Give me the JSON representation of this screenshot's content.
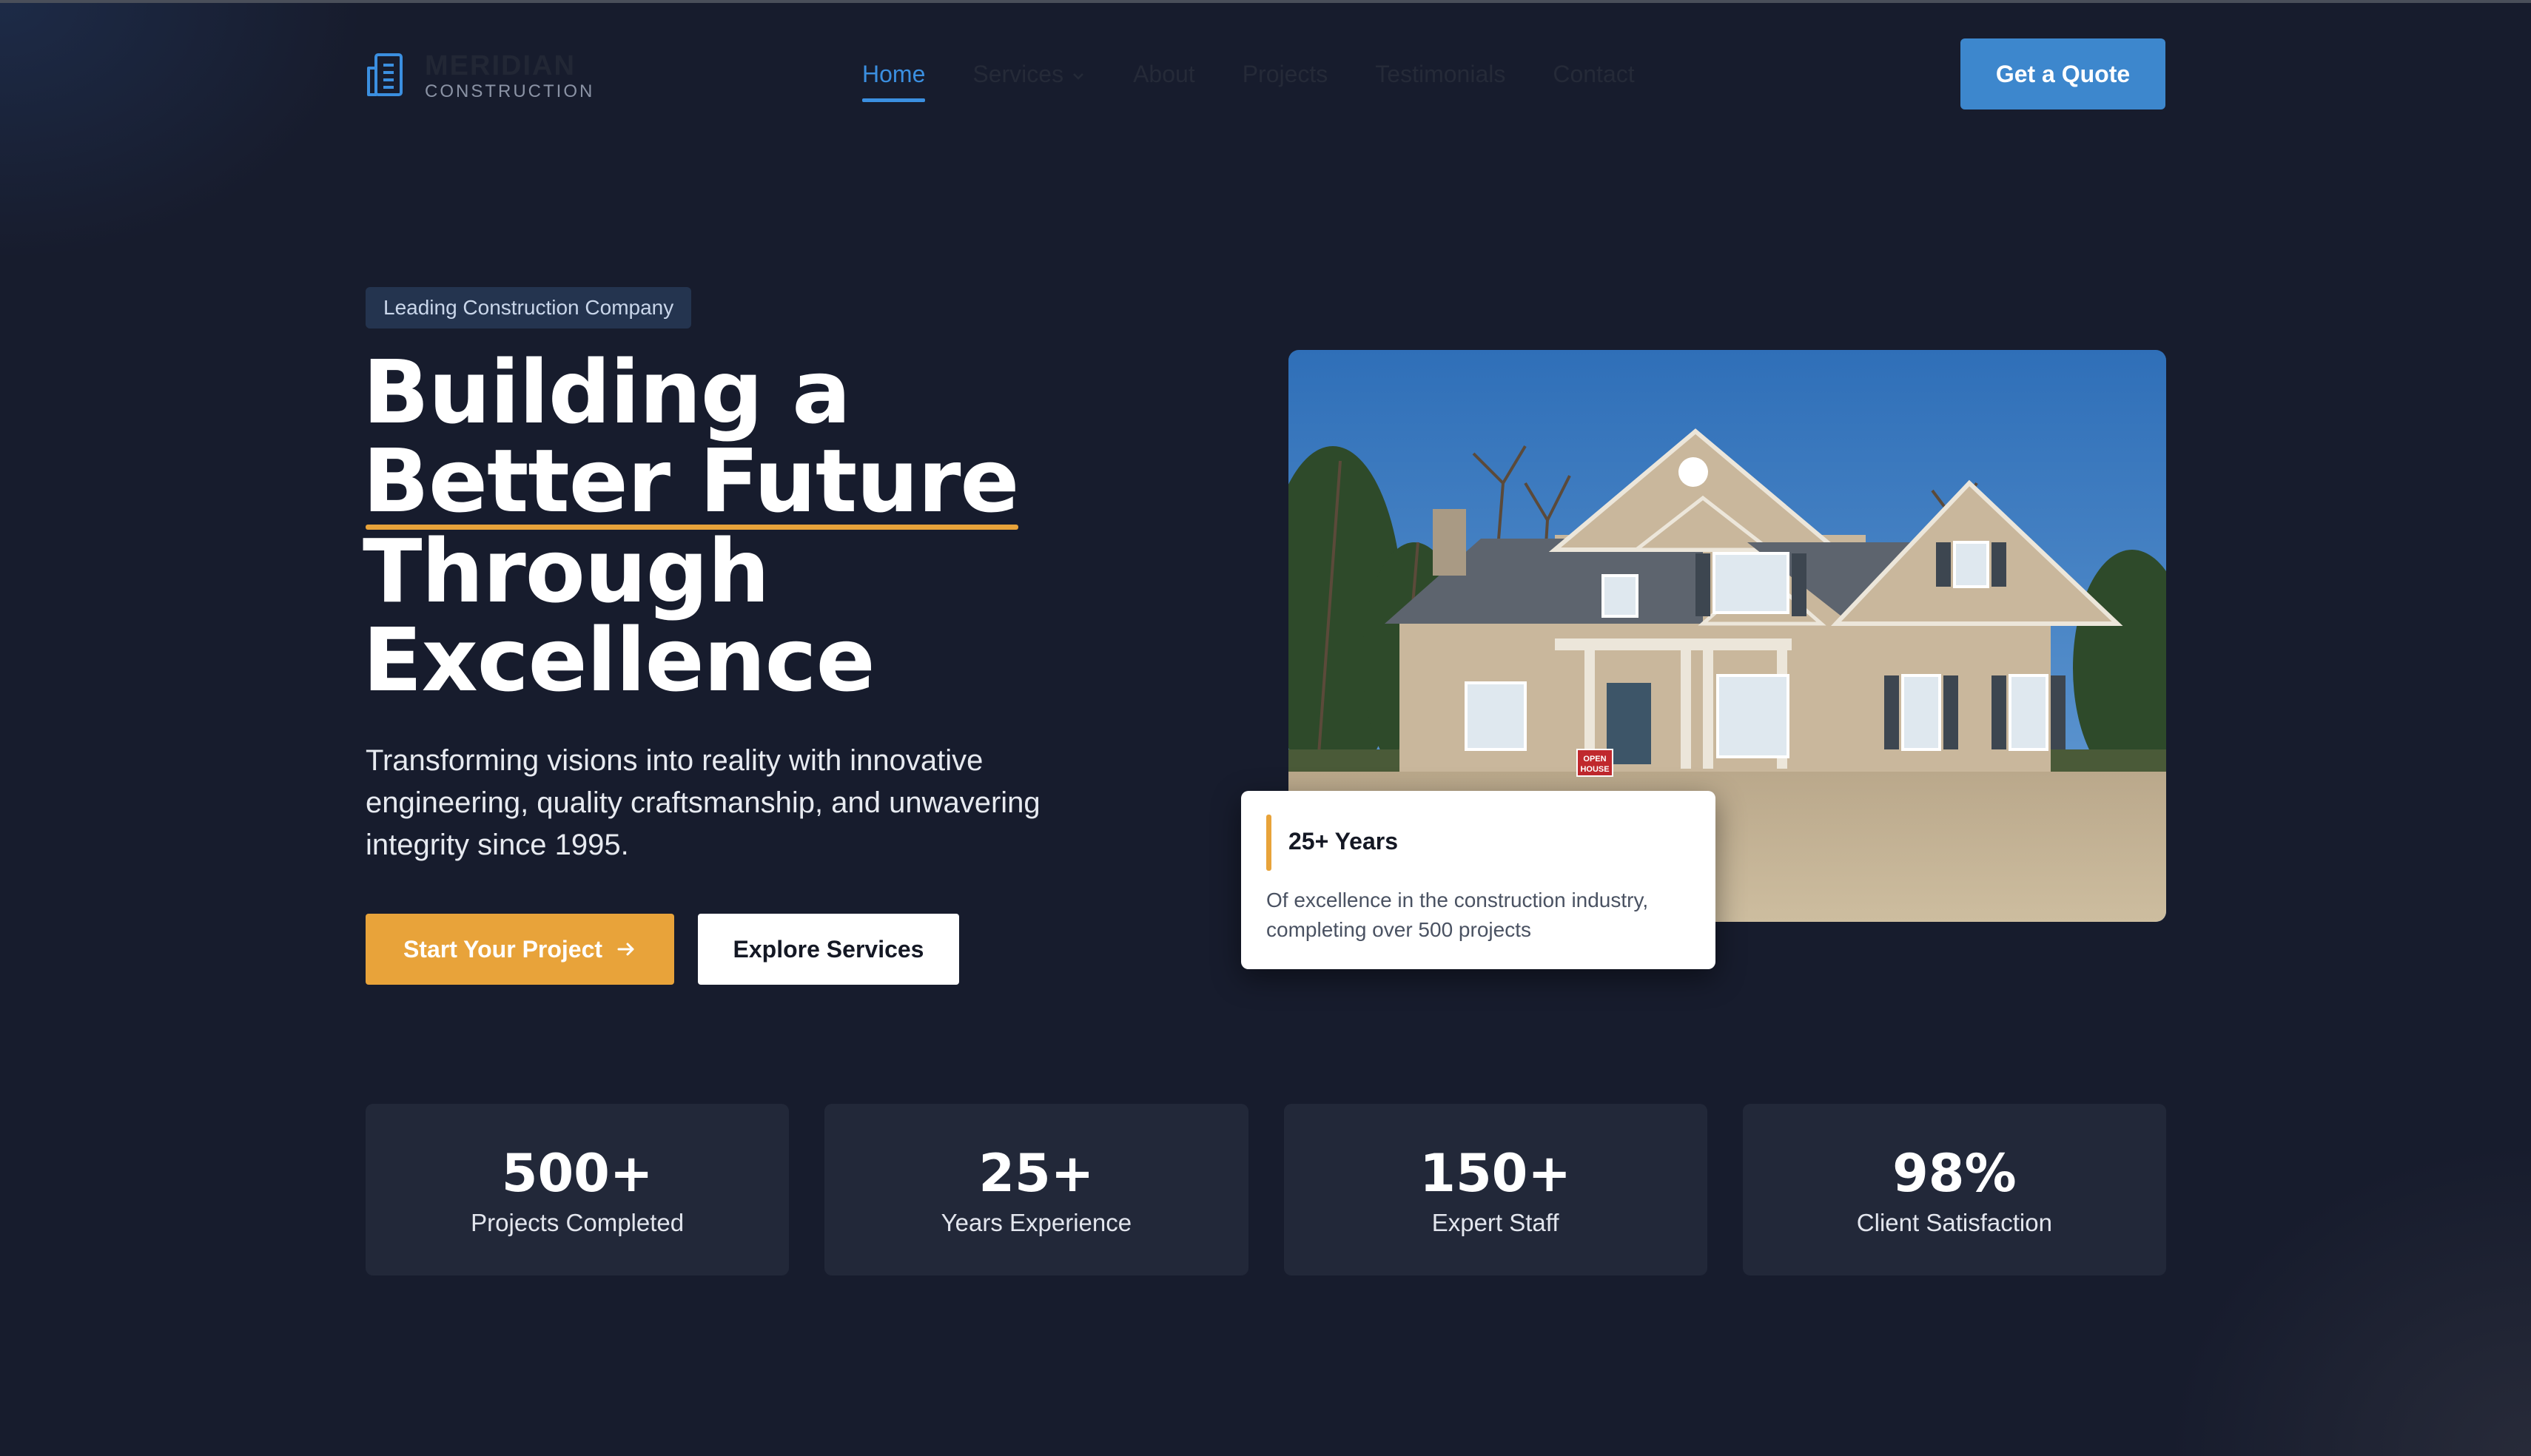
{
  "brand": {
    "name": "MERIDIAN",
    "subtitle": "CONSTRUCTION"
  },
  "nav": {
    "items": [
      {
        "label": "Home",
        "active": true
      },
      {
        "label": "Services",
        "has_dropdown": true
      },
      {
        "label": "About"
      },
      {
        "label": "Projects"
      },
      {
        "label": "Testimonials"
      },
      {
        "label": "Contact"
      }
    ],
    "cta_label": "Get a Quote"
  },
  "hero": {
    "badge": "Leading Construction Company",
    "title_lines": [
      "Building a",
      "Better Future",
      "Through",
      "Excellence"
    ],
    "highlight_line": "Better Future",
    "subtitle": "Transforming visions into reality with innovative engineering, quality craftsmanship, and unwavering integrity since 1995.",
    "primary_button": "Start Your Project",
    "secondary_button": "Explore Services"
  },
  "experience_card": {
    "title": "25+ Years",
    "text": "Of excellence in the construction industry, completing over 500 projects"
  },
  "photo": {
    "sign_text": [
      "OPEN",
      "HOUSE"
    ]
  },
  "stats": [
    {
      "value": "500+",
      "label": "Projects Completed"
    },
    {
      "value": "25+",
      "label": "Years Experience"
    },
    {
      "value": "150+",
      "label": "Expert Staff"
    },
    {
      "value": "98%",
      "label": "Client Satisfaction"
    }
  ],
  "colors": {
    "accent_blue": "#3d87cd",
    "accent_orange": "#e8a33a",
    "background": "#171c2d",
    "card_background": "#222839"
  },
  "icons": {
    "logo": "building-icon",
    "dropdown": "chevron-down-icon",
    "arrow": "arrow-right-icon"
  }
}
